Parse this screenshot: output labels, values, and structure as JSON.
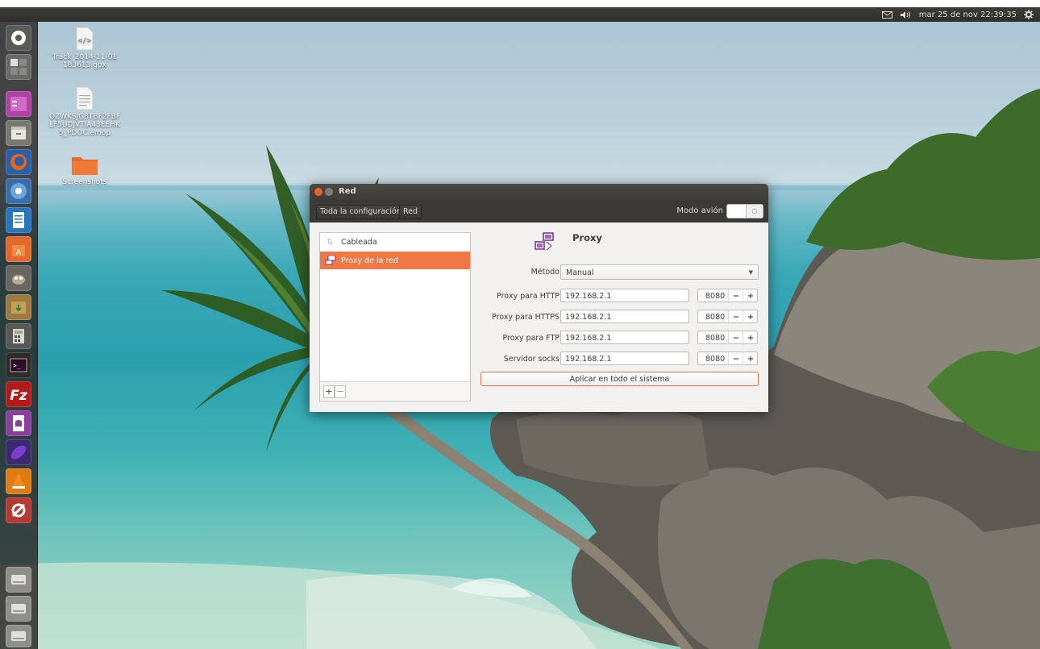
{
  "top_panel": {
    "datetime": "mar 25 de nov 22:39:35",
    "indicators": [
      "mail-icon",
      "volume-icon",
      "gear-icon"
    ]
  },
  "launcher": {
    "items": [
      "dash-icon",
      "workspace-icon",
      "files-icon",
      "archive-icon",
      "firefox-icon",
      "chromium-icon",
      "writer-icon",
      "software-center-icon",
      "gimp-icon",
      "installer-icon",
      "calculator-icon",
      "terminal-icon",
      "filezilla-icon",
      "base-icon",
      "eclipse-icon",
      "vlc-icon",
      "settings-icon",
      "drive-icon",
      "drive-icon",
      "drive-icon"
    ]
  },
  "desktop": {
    "icons": [
      {
        "label": "Track_2014-11-01\n183613.gpx",
        "icon": "code-file-icon"
      },
      {
        "label": "OZWKSJG3TBF2FBF\nLF5UDJVTIA43EEHK\n5_PDOC.emop",
        "icon": "text-file-icon"
      },
      {
        "label": "Screenshots",
        "icon": "folder-icon"
      }
    ]
  },
  "window": {
    "title": "Red",
    "breadcrumb": {
      "all_settings": "Toda la configuración",
      "current": "Red"
    },
    "airplane_label": "Modo avión",
    "connections": [
      {
        "label": "Cableada",
        "icon": "wired-icon",
        "selected": false
      },
      {
        "label": "Proxy de la red",
        "icon": "proxy-icon",
        "selected": true
      }
    ],
    "list_buttons": {
      "add": "+",
      "remove": "−"
    },
    "proxy": {
      "title": "Proxy",
      "method_label": "Método",
      "method_value": "Manual",
      "fields": [
        {
          "label": "Proxy para HTTP",
          "host": "192.168.2.1",
          "port": "8080"
        },
        {
          "label": "Proxy para HTTPS",
          "host": "192.168.2.1",
          "port": "8080"
        },
        {
          "label": "Proxy para FTP",
          "host": "192.168.2.1",
          "port": "8080"
        },
        {
          "label": "Servidor socks",
          "host": "192.168.2.1",
          "port": "8080"
        }
      ],
      "stepper": {
        "minus": "−",
        "plus": "+"
      },
      "apply_label": "Aplicar en todo el sistema"
    }
  },
  "colors": {
    "accent": "#f07746",
    "panel": "#3c3b37",
    "window_bg": "#f2f1f0"
  }
}
